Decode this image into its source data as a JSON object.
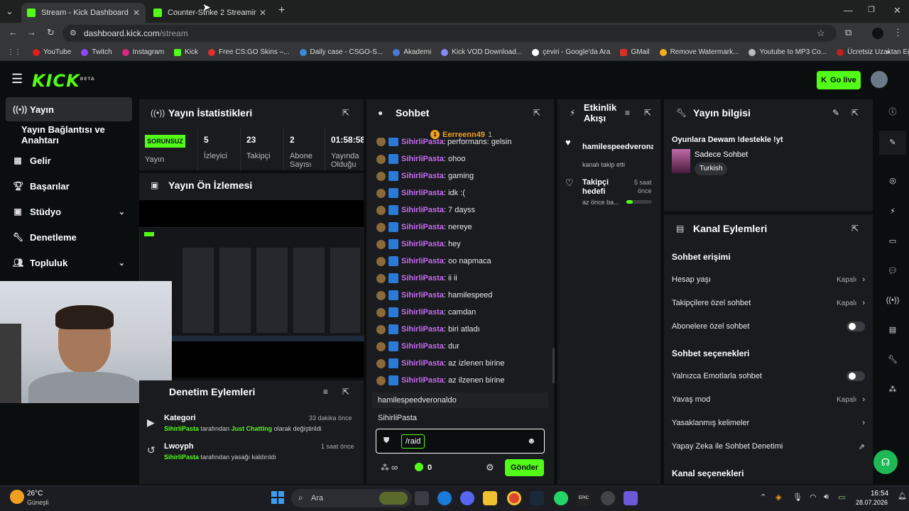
{
  "browser": {
    "tabs": [
      {
        "title": "Stream - Kick Dashboard"
      },
      {
        "title": "Counter-Strike 2 Streaming - Li"
      }
    ],
    "url_host": "dashboard.kick.com",
    "url_path": "/stream",
    "bookmarks": [
      "YouTube",
      "Twitch",
      "Instagram",
      "Kick",
      "Free CS:GO Skins –...",
      "Daily case - CSGO-S...",
      "Akademi",
      "Kick VOD Download...",
      "çeviri - Google'da Ara",
      "GMail",
      "Remove Watermark...",
      "Youtube to MP3 Co...",
      "Ücretsiz Uzaktan Eği..."
    ]
  },
  "header": {
    "logo": "KICK",
    "beta": "BETA",
    "go_live": "Go live"
  },
  "sidebar": {
    "items": [
      {
        "label": "Yayın"
      },
      {
        "label": "Yayın Bağlantısı ve Anahtarı"
      },
      {
        "label": "Gelir"
      },
      {
        "label": "Başarılar"
      },
      {
        "label": "Stüdyo"
      },
      {
        "label": "Denetleme"
      },
      {
        "label": "Topluluk"
      }
    ]
  },
  "stats": {
    "title": "Yayın İstatistikleri",
    "badge": "SORUNSUZ",
    "badge_label": "Yayın",
    "items": [
      {
        "value": "5",
        "label": "İzleyici"
      },
      {
        "value": "23",
        "label": "Takipçi"
      },
      {
        "value": "2",
        "label": "Abone Sayısı"
      },
      {
        "value": "01:58:58",
        "label": "Yayında Olduğu"
      }
    ]
  },
  "preview": {
    "title": "Yayın Ön İzlemesi"
  },
  "moderation": {
    "title": "Denetim Eylemleri",
    "items": [
      {
        "title": "Kategori",
        "time": "33 dakika önce",
        "user": "SihirliPasta",
        "text1": "tarafından",
        "value": "Just Chatting",
        "text2": "olarak değiştirildi"
      },
      {
        "title": "Lwoyph",
        "time": "1 saat önce",
        "user": "SihirliPasta",
        "text1": "tarafından yasağı kaldırıldı",
        "value": "",
        "text2": ""
      }
    ]
  },
  "chat": {
    "title": "Sohbet",
    "pinned_user": "Eerreenn49",
    "pinned_count": "1",
    "cut_line": "performans: gelsin",
    "messages": [
      {
        "user": "SihirliPasta",
        "text": "ohoo"
      },
      {
        "user": "SihirliPasta",
        "text": "gaming"
      },
      {
        "user": "SihirliPasta",
        "text": "idk :("
      },
      {
        "user": "SihirliPasta",
        "text": "7 dayss"
      },
      {
        "user": "SihirliPasta",
        "text": "nereye"
      },
      {
        "user": "SihirliPasta",
        "text": "hey"
      },
      {
        "user": "SihirliPasta",
        "text": "oo napmaca"
      },
      {
        "user": "SihirliPasta",
        "text": "ii ii"
      },
      {
        "user": "SihirliPasta",
        "text": "hamilespeed"
      },
      {
        "user": "SihirliPasta",
        "text": "camdan"
      },
      {
        "user": "SihirliPasta",
        "text": "biri atladı"
      },
      {
        "user": "SihirliPasta",
        "text": "dur"
      },
      {
        "user": "SihirliPasta",
        "text": "az izlenen birine"
      },
      {
        "user": "SihirliPasta",
        "text": "az ilzenen birine"
      }
    ],
    "suggestions": [
      "hamilespeedveronaldo",
      "SihirliPasta"
    ],
    "input_value": "/raid",
    "kicks": "0",
    "send": "Gönder"
  },
  "activity": {
    "title_line1": "Etkinlik",
    "title_line2": "Akışı",
    "follow_user": "hamilespeedverona",
    "follow_text": "kanalı takip etti",
    "goal_title_line1": "Takipçi",
    "goal_title_line2": "hedefi",
    "goal_time_line1": "5 saat",
    "goal_time_line2": "önce",
    "goal_sub": "az önce ba...",
    "goal_progress": 0.25
  },
  "info": {
    "title": "Yayın bilgisi",
    "stream_title": "Oyunlara Dewam !destekle !yt",
    "category": "Sadece Sohbet",
    "language": "Turkish"
  },
  "channel": {
    "title": "Kanal Eylemleri",
    "chat_access": "Sohbet erişimi",
    "account_age": "Hesap yaşı",
    "account_age_val": "Kapalı",
    "followers_only": "Takipçilere özel sohbet",
    "followers_only_val": "Kapalı",
    "subs_only": "Abonelere özel sohbet",
    "chat_options": "Sohbet seçenekleri",
    "emote_only": "Yalnızca Emotlarla sohbet",
    "slow_mode": "Yavaş mod",
    "slow_mode_val": "Kapalı",
    "banned_words": "Yasaklanmış kelimeler",
    "ai_mod": "Yapay Zeka ile Sohbet Denetimi",
    "channel_options": "Kanal seçenekleri"
  },
  "taskbar": {
    "weather_temp": "26°C",
    "weather_text": "Güneşli",
    "search": "Ara",
    "time": "16:54",
    "date": "28.07.2026"
  },
  "colors": {
    "accent": "#53fc18",
    "username": "#c66cf0",
    "panel": "#191b1f",
    "bg": "#0b0e0f"
  }
}
